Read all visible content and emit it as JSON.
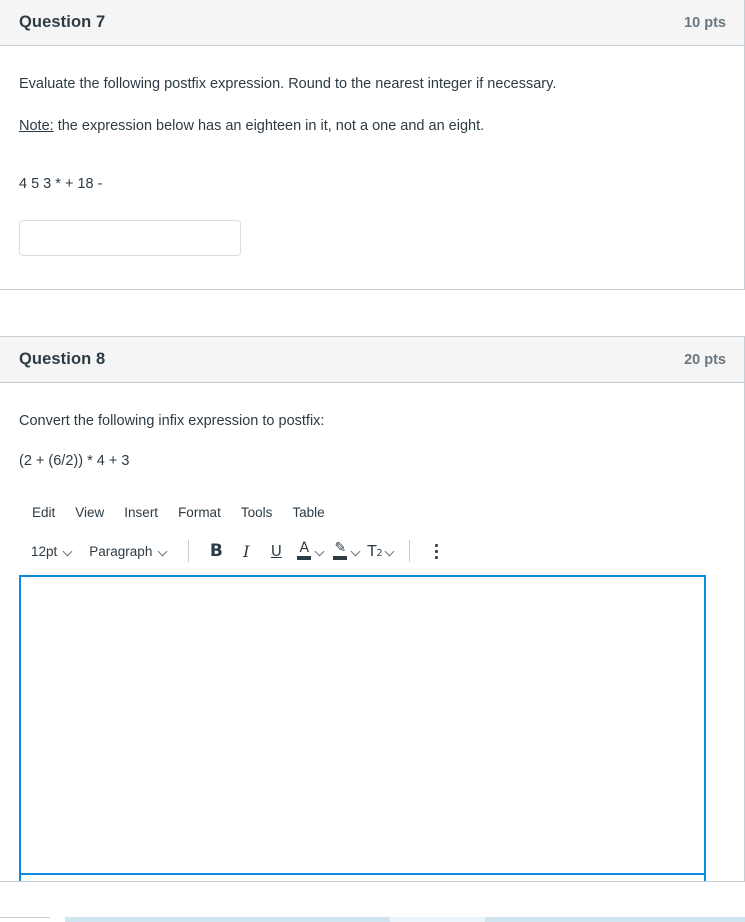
{
  "questions": [
    {
      "title": "Question 7",
      "points": "10 pts",
      "prompt": "Evaluate the following postfix expression. Round to the nearest integer if necessary.",
      "note_label": "Note:",
      "note_text": " the expression below has an eighteen in it, not a one and an eight.",
      "expression": "4 5 3 * + 18 -",
      "answer_value": "",
      "answer_placeholder": ""
    },
    {
      "title": "Question 8",
      "points": "20 pts",
      "prompt": "Convert the following infix expression to postfix:",
      "expression": "(2 + (6/2)) * 4 + 3"
    }
  ],
  "editor": {
    "menubar": [
      {
        "label": "Edit"
      },
      {
        "label": "View"
      },
      {
        "label": "Insert"
      },
      {
        "label": "Format"
      },
      {
        "label": "Tools"
      },
      {
        "label": "Table"
      }
    ],
    "toolbar": {
      "font_size": "12pt",
      "block_format": "Paragraph",
      "bold_label": "B",
      "italic_label": "I",
      "underline_label": "U",
      "text_color_glyph": "A",
      "highlight_glyph": "✎",
      "superscript_label": "T",
      "superscript_exponent": "2",
      "more_label": "⋮"
    },
    "body_value": "",
    "focus_color": "#0e8ade"
  },
  "colors": {
    "card_border": "#c7cdd1",
    "header_bg": "#f5f5f5",
    "text": "#2d3b45",
    "muted_text": "#6b7780",
    "input_border": "#dddddd",
    "editor_focus": "#0e8ade"
  }
}
